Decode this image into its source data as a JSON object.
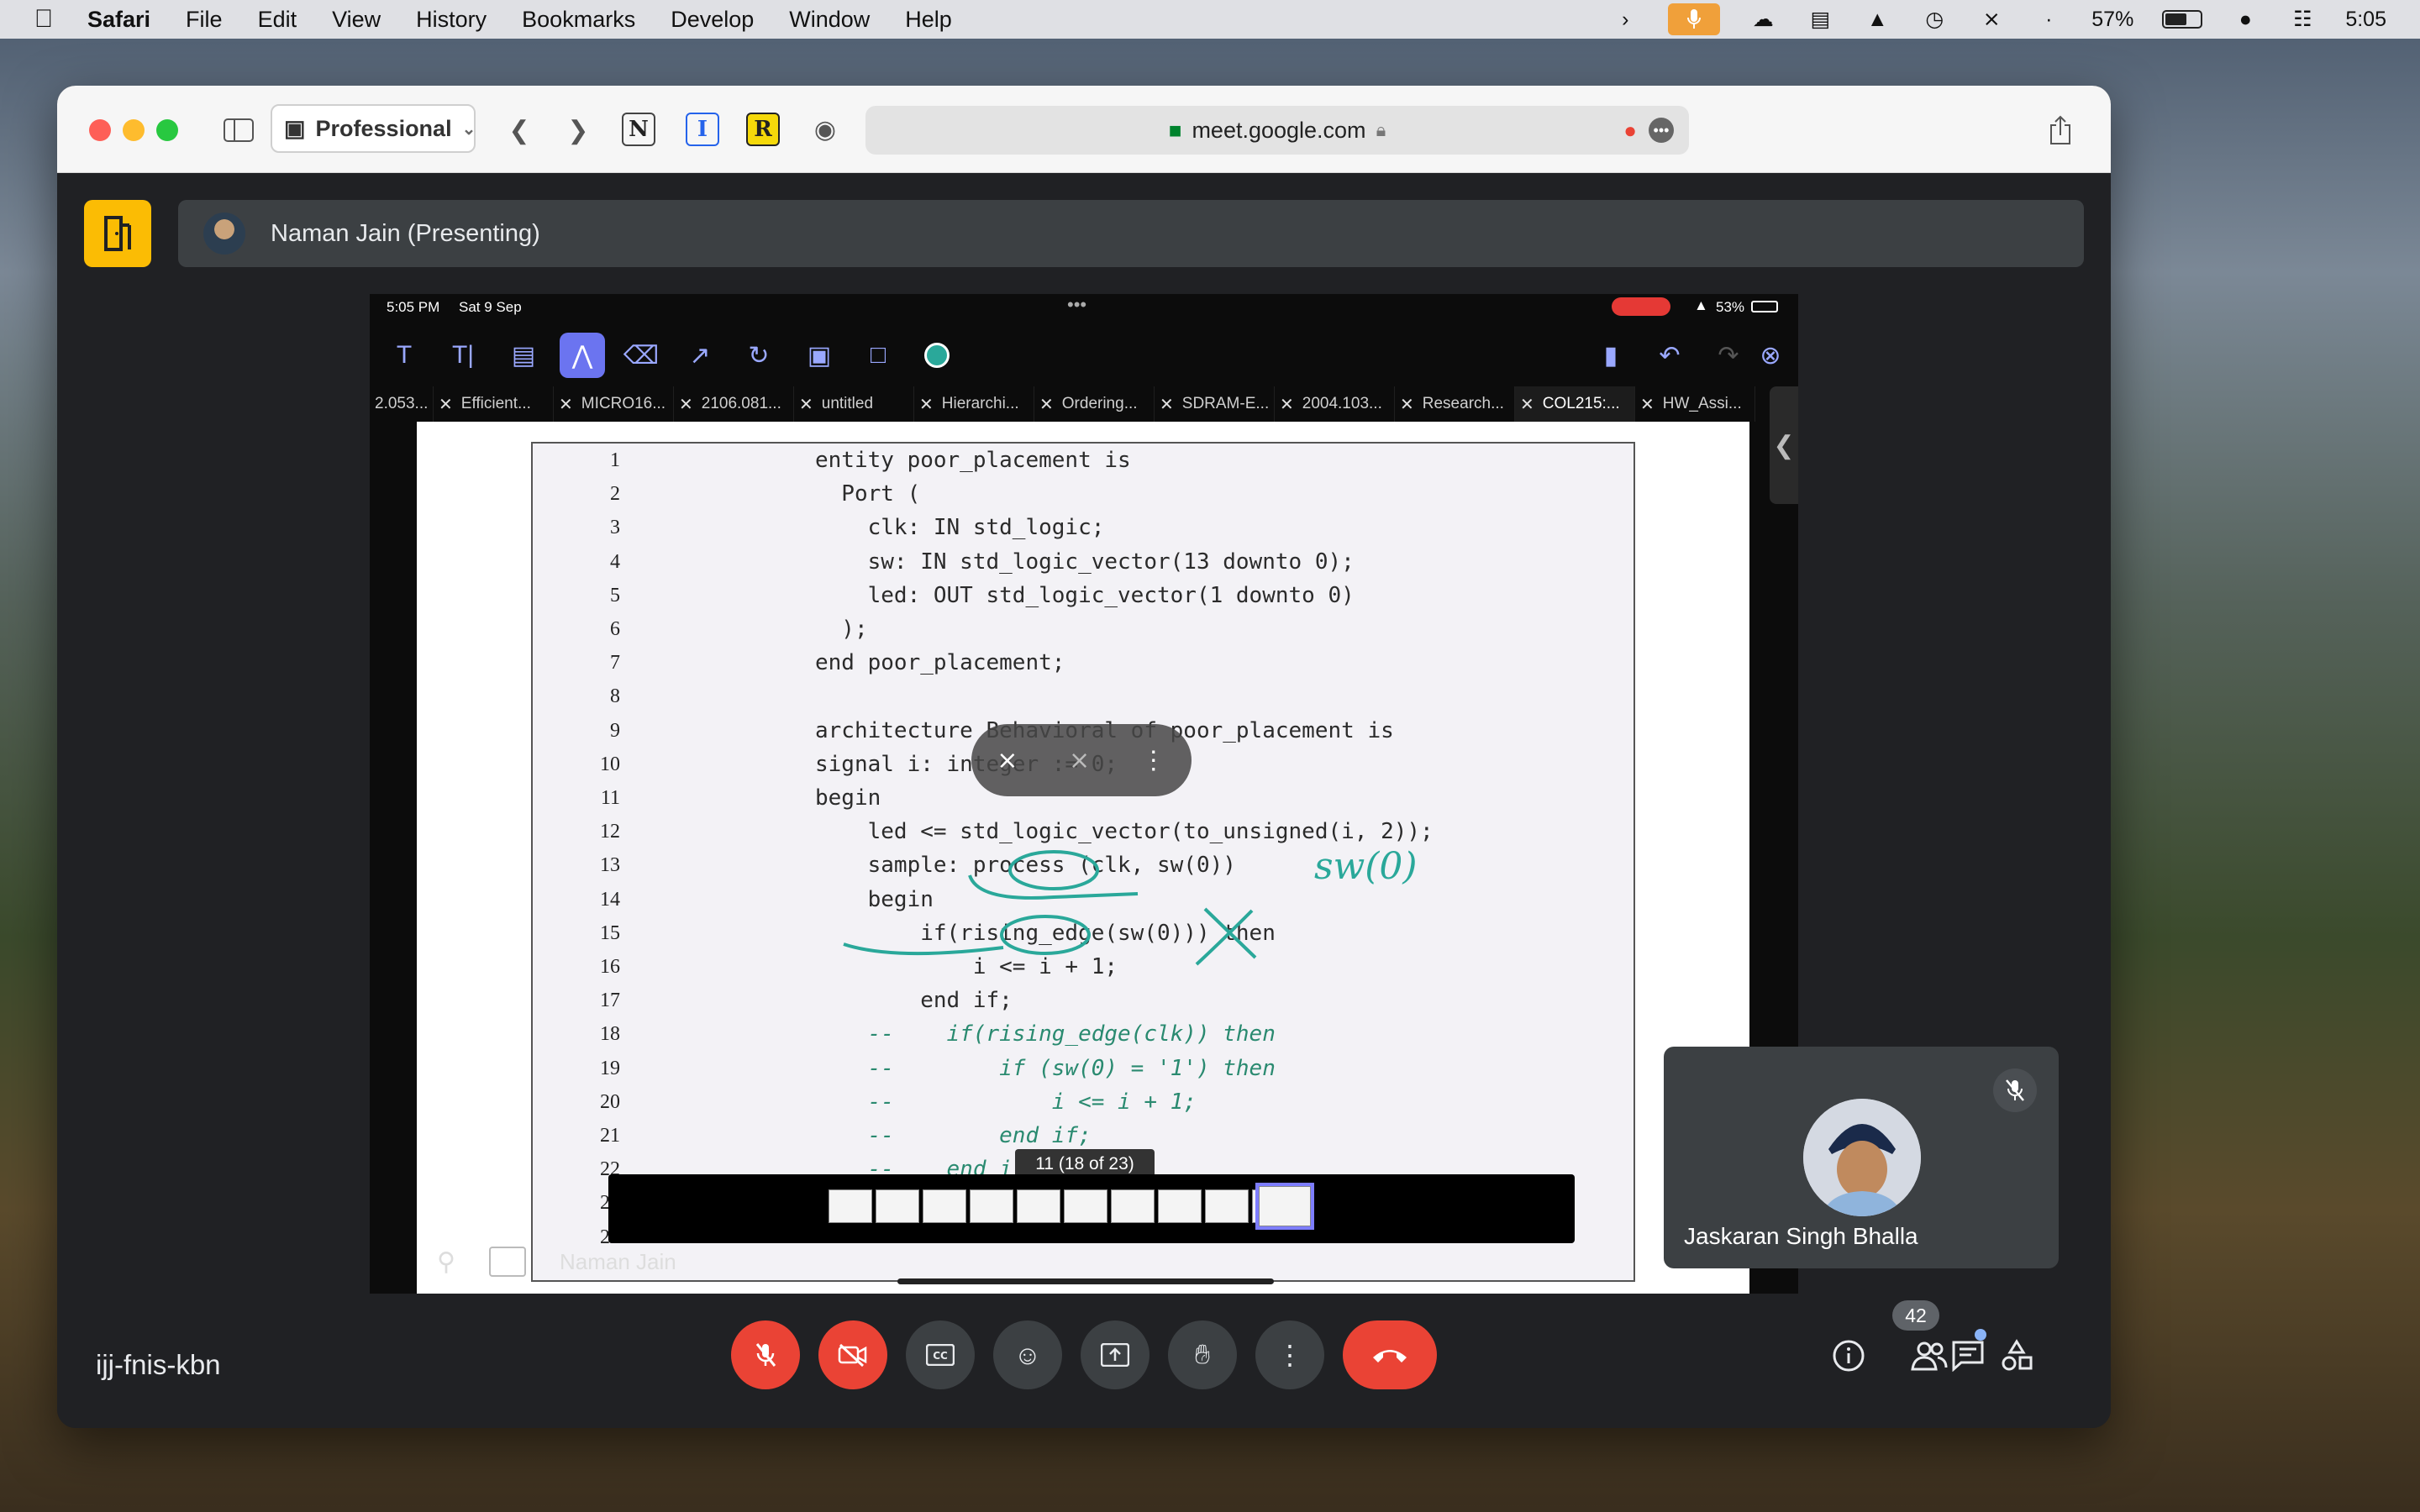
{
  "menubar": {
    "app_name": "Safari",
    "menus": [
      "File",
      "Edit",
      "View",
      "History",
      "Bookmarks",
      "Develop",
      "Window",
      "Help"
    ],
    "battery_percent": "57%",
    "clock": "5:05"
  },
  "browser": {
    "profile": "Professional",
    "url": "meet.google.com"
  },
  "meet": {
    "presenter_banner": "Naman Jain (Presenting)",
    "meeting_code": "ijj-fnis-kbn",
    "people_count": "42",
    "participant_name": "Jaskaran Singh Bhalla",
    "presenter_label": "Naman Jain"
  },
  "ipad": {
    "time": "5:05 PM",
    "date": "Sat 9 Sep",
    "battery": "53%",
    "tabs": [
      {
        "label": "2.053..."
      },
      {
        "label": "Efficient..."
      },
      {
        "label": "MICRO16..."
      },
      {
        "label": "2106.081..."
      },
      {
        "label": "untitled"
      },
      {
        "label": "Hierarchi..."
      },
      {
        "label": "Ordering..."
      },
      {
        "label": "SDRAM-E..."
      },
      {
        "label": "2004.103..."
      },
      {
        "label": "Research..."
      },
      {
        "label": "COL215:..."
      },
      {
        "label": "HW_Assi..."
      }
    ],
    "page_indicator": "11 (18 of 23)",
    "annotation_text": "sw(0)",
    "code_lines": [
      {
        "n": "1",
        "text": "entity poor_placement is"
      },
      {
        "n": "2",
        "text": "  Port ("
      },
      {
        "n": "3",
        "text": "    clk: IN std_logic;"
      },
      {
        "n": "4",
        "text": "    sw: IN std_logic_vector(13 downto 0);"
      },
      {
        "n": "5",
        "text": "    led: OUT std_logic_vector(1 downto 0)"
      },
      {
        "n": "6",
        "text": "  );"
      },
      {
        "n": "7",
        "text": "end poor_placement;"
      },
      {
        "n": "8",
        "text": ""
      },
      {
        "n": "9",
        "text": "architecture Behavioral of poor_placement is"
      },
      {
        "n": "10",
        "text": "signal i: integer := 0;"
      },
      {
        "n": "11",
        "text": "begin"
      },
      {
        "n": "12",
        "text": "    led <= std_logic_vector(to_unsigned(i, 2));"
      },
      {
        "n": "13",
        "text": "    sample: process (clk, sw(0))"
      },
      {
        "n": "14",
        "text": "    begin"
      },
      {
        "n": "15",
        "text": "        if(rising_edge(sw(0))) then"
      },
      {
        "n": "16",
        "text": "            i <= i + 1;"
      },
      {
        "n": "17",
        "text": "        end if;"
      },
      {
        "n": "18",
        "text": "    --    if(rising_edge(clk)) then"
      },
      {
        "n": "19",
        "text": "    --        if (sw(0) = '1') then"
      },
      {
        "n": "20",
        "text": "    --            i <= i + 1;"
      },
      {
        "n": "21",
        "text": "    --        end if;"
      },
      {
        "n": "22",
        "text": "    --    end if;"
      },
      {
        "n": "23",
        "text": ""
      },
      {
        "n": "24",
        "text": ""
      }
    ]
  },
  "colors": {
    "meet_red": "#ea4335",
    "exit_yellow": "#fbbc04",
    "annotation_teal": "#2aa89a",
    "tool_active": "#6b74f0"
  }
}
